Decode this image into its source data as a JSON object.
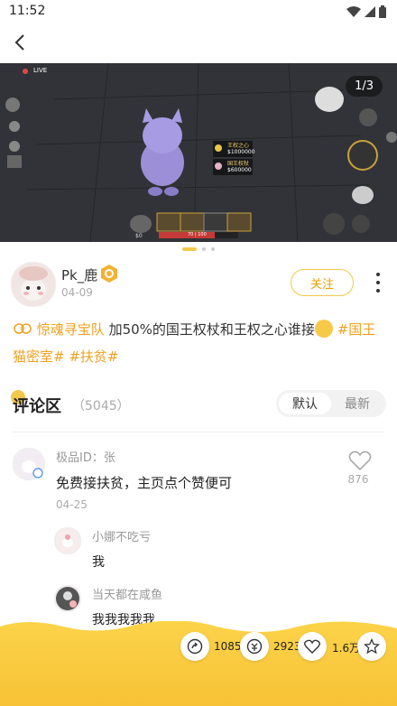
{
  "status": {
    "time": "11:52"
  },
  "media": {
    "counter": "1/3",
    "live_label": "LIVE",
    "popup_1_label": "王权之心",
    "popup_1_value": "$1000000",
    "popup_2_label": "国王权杖",
    "popup_2_value": "$600000",
    "money": "$0",
    "hp": "70 | 100",
    "slide_total": 3,
    "slide_active": 1
  },
  "author": {
    "name": "Pk_鹿",
    "date": "04-09",
    "follow_label": "关注"
  },
  "post": {
    "team": "惊魂寻宝队",
    "text": "加50%的国王权杖和王权之心谁接",
    "tag1": "#国王猫密室#",
    "tag2": "#扶贫#"
  },
  "comments": {
    "title": "评论区",
    "count": "（5045）",
    "sort_default": "默认",
    "sort_latest": "最新",
    "items": [
      {
        "user": "极品ID：张",
        "text": "免费接扶贫，主页点个赞便可",
        "date": "04-25",
        "likes": "876",
        "replies": [
          {
            "user": "小娜不吃亏",
            "text": "我"
          },
          {
            "user": "当天都在咸鱼",
            "text": "我我我我我"
          }
        ]
      }
    ]
  },
  "bottom": {
    "share_count": "1085",
    "coin_count": "2923",
    "like_count": "1.6万"
  },
  "colors": {
    "accent": "#f2c84b",
    "tag": "#f0a020"
  }
}
